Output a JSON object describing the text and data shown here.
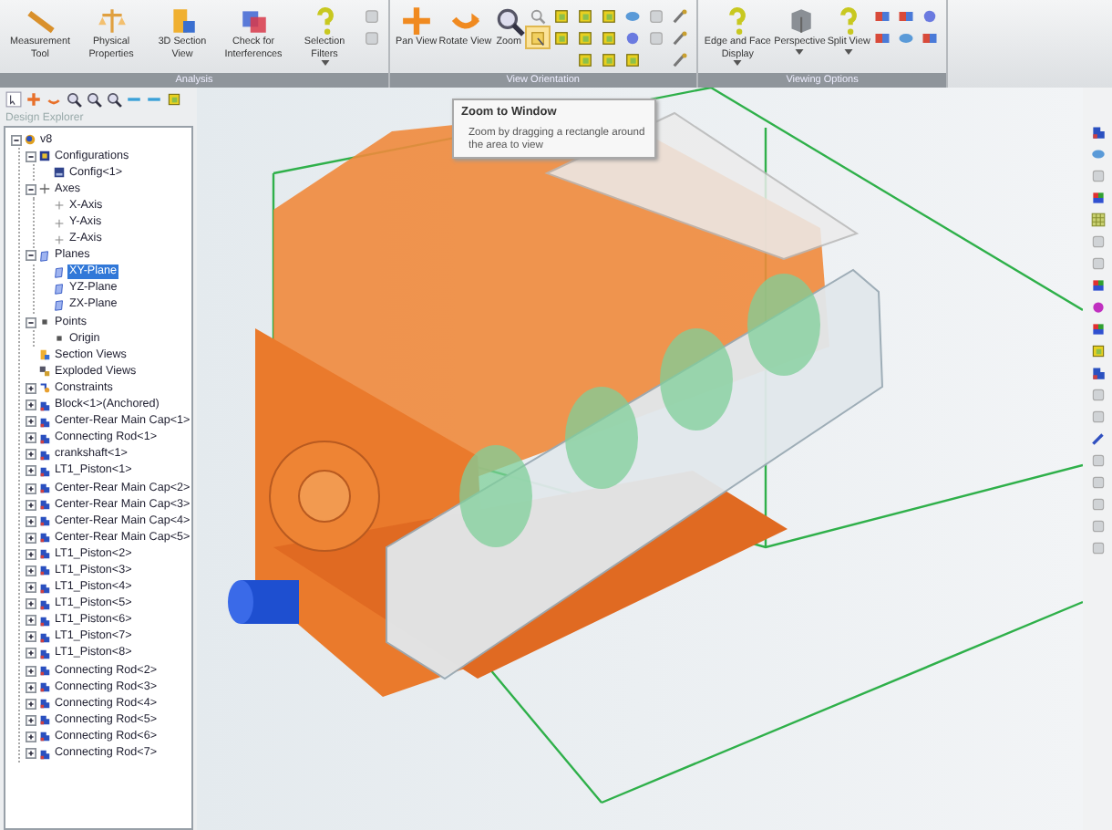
{
  "ribbon": {
    "groups": [
      {
        "label": "Analysis",
        "buttons": [
          {
            "label": "Measurement Tool",
            "kind": "ruler",
            "dropdown": false
          },
          {
            "label": "Physical Properties",
            "kind": "properties",
            "dropdown": false
          },
          {
            "label": "3D Section View",
            "kind": "section",
            "dropdown": false
          },
          {
            "label": "Check for Interferences",
            "kind": "interference",
            "dropdown": false
          },
          {
            "label": "Selection Filters",
            "kind": "question",
            "dropdown": true
          }
        ],
        "small_columns": [
          [
            {
              "kind": "grey",
              "highlighted": false
            },
            {
              "kind": "grey",
              "highlighted": false
            }
          ]
        ]
      },
      {
        "label": "View Orientation",
        "buttons": [
          {
            "label": "Pan View",
            "kind": "pan",
            "dropdown": false
          },
          {
            "label": "Rotate View",
            "kind": "rotate",
            "dropdown": false
          },
          {
            "label": "Zoom",
            "kind": "zoom",
            "dropdown": false
          }
        ],
        "small_columns": [
          [
            {
              "kind": "zoomgrey",
              "highlighted": false
            },
            {
              "kind": "zoomwin",
              "highlighted": true
            }
          ],
          [
            {
              "kind": "cube",
              "highlighted": false
            },
            {
              "kind": "cube",
              "highlighted": false
            }
          ],
          [
            {
              "kind": "cube",
              "highlighted": false
            },
            {
              "kind": "cube",
              "highlighted": false
            },
            {
              "kind": "cube",
              "highlighted": false
            }
          ],
          [
            {
              "kind": "cube",
              "highlighted": false
            },
            {
              "kind": "cube",
              "highlighted": false
            },
            {
              "kind": "cube",
              "highlighted": false
            }
          ],
          [
            {
              "kind": "blue",
              "highlighted": false
            },
            {
              "kind": "sphere",
              "highlighted": false
            },
            {
              "kind": "cube",
              "highlighted": false
            }
          ],
          [
            {
              "kind": "grey",
              "highlighted": false
            },
            {
              "kind": "grey",
              "highlighted": false
            }
          ],
          [
            {
              "kind": "tool",
              "highlighted": false
            },
            {
              "kind": "tool",
              "highlighted": false
            },
            {
              "kind": "tool",
              "highlighted": false
            }
          ]
        ]
      },
      {
        "label": "Viewing Options",
        "buttons": [
          {
            "label": "Edge and Face Display",
            "kind": "question",
            "dropdown": true
          },
          {
            "label": "Perspective",
            "kind": "perspective",
            "dropdown": true
          },
          {
            "label": "Split View",
            "kind": "question",
            "dropdown": true
          }
        ],
        "small_columns": [
          [
            {
              "kind": "color",
              "highlighted": false
            },
            {
              "kind": "color",
              "highlighted": false
            }
          ],
          [
            {
              "kind": "color",
              "highlighted": false
            },
            {
              "kind": "blue",
              "highlighted": false
            }
          ],
          [
            {
              "kind": "sphere",
              "highlighted": false
            },
            {
              "kind": "color",
              "highlighted": false
            }
          ]
        ]
      }
    ]
  },
  "toolbar": [
    {
      "kind": "select"
    },
    {
      "kind": "add"
    },
    {
      "kind": "undo"
    },
    {
      "kind": "zoom"
    },
    {
      "kind": "zoom"
    },
    {
      "kind": "zoom"
    },
    {
      "kind": "line"
    },
    {
      "kind": "line"
    },
    {
      "kind": "cube"
    }
  ],
  "explorer": {
    "title": "Design Explorer",
    "items": [
      {
        "label": "v8",
        "kind": "assembly",
        "selected": false,
        "expanded": true,
        "children": [
          {
            "label": "Configurations",
            "kind": "configs",
            "selected": false,
            "expanded": true,
            "children": [
              {
                "label": "Config<1>",
                "kind": "config",
                "selected": false
              }
            ]
          },
          {
            "label": "Axes",
            "kind": "axes",
            "selected": false,
            "expanded": true,
            "children": [
              {
                "label": "X-Axis",
                "kind": "axis",
                "selected": false
              },
              {
                "label": "Y-Axis",
                "kind": "axis",
                "selected": false
              },
              {
                "label": "Z-Axis",
                "kind": "axis",
                "selected": false
              }
            ]
          },
          {
            "label": "Planes",
            "kind": "plane",
            "selected": false,
            "expanded": true,
            "children": [
              {
                "label": "XY-Plane",
                "kind": "plane",
                "selected": true
              },
              {
                "label": "YZ-Plane",
                "kind": "plane",
                "selected": false
              },
              {
                "label": "ZX-Plane",
                "kind": "plane",
                "selected": false
              }
            ]
          },
          {
            "label": "Points",
            "kind": "point",
            "selected": false,
            "expanded": true,
            "children": [
              {
                "label": "Origin",
                "kind": "point",
                "selected": false
              }
            ]
          },
          {
            "label": "Section Views",
            "kind": "section",
            "selected": false
          },
          {
            "label": "Exploded Views",
            "kind": "exploded",
            "selected": false
          },
          {
            "label": "Constraints",
            "kind": "constraints",
            "selected": false,
            "expanded": false
          },
          {
            "label": "Block<1>(Anchored)",
            "kind": "part",
            "selected": false,
            "expanded": false
          },
          {
            "label": "Center-Rear Main Cap<1>",
            "kind": "part",
            "selected": false,
            "expanded": false
          },
          {
            "label": "Connecting Rod<1>",
            "kind": "part",
            "selected": false,
            "expanded": false
          },
          {
            "label": "crankshaft<1>",
            "kind": "part",
            "selected": false,
            "expanded": false
          },
          {
            "label": "LT1_Piston<1>",
            "kind": "part",
            "selected": false,
            "expanded": false
          },
          {
            "label": "Center-Rear Main Cap<2>",
            "kind": "part",
            "selected": false,
            "expanded": false
          },
          {
            "label": "Center-Rear Main Cap<3>",
            "kind": "part",
            "selected": false,
            "expanded": false
          },
          {
            "label": "Center-Rear Main Cap<4>",
            "kind": "part",
            "selected": false,
            "expanded": false
          },
          {
            "label": "Center-Rear Main Cap<5>",
            "kind": "part",
            "selected": false,
            "expanded": false
          },
          {
            "label": "LT1_Piston<2>",
            "kind": "part",
            "selected": false,
            "expanded": false
          },
          {
            "label": "LT1_Piston<3>",
            "kind": "part",
            "selected": false,
            "expanded": false
          },
          {
            "label": "LT1_Piston<4>",
            "kind": "part",
            "selected": false,
            "expanded": false
          },
          {
            "label": "LT1_Piston<5>",
            "kind": "part",
            "selected": false,
            "expanded": false
          },
          {
            "label": "LT1_Piston<6>",
            "kind": "part",
            "selected": false,
            "expanded": false
          },
          {
            "label": "LT1_Piston<7>",
            "kind": "part",
            "selected": false,
            "expanded": false
          },
          {
            "label": "LT1_Piston<8>",
            "kind": "part",
            "selected": false,
            "expanded": false
          },
          {
            "label": "Connecting Rod<2>",
            "kind": "part",
            "selected": false,
            "expanded": false
          },
          {
            "label": "Connecting Rod<3>",
            "kind": "part",
            "selected": false,
            "expanded": false
          },
          {
            "label": "Connecting Rod<4>",
            "kind": "part",
            "selected": false,
            "expanded": false
          },
          {
            "label": "Connecting Rod<5>",
            "kind": "part",
            "selected": false,
            "expanded": false
          },
          {
            "label": "Connecting Rod<6>",
            "kind": "part",
            "selected": false,
            "expanded": false
          },
          {
            "label": "Connecting Rod<7>",
            "kind": "part",
            "selected": false,
            "expanded": false
          }
        ]
      }
    ]
  },
  "tooltip": {
    "title": "Zoom to Window",
    "text": "Zoom by dragging a rectangle around the area to view"
  },
  "side_toolbar": [
    {
      "kind": "part"
    },
    {
      "kind": "blue"
    },
    {
      "kind": "grey"
    },
    {
      "kind": "colorcube"
    },
    {
      "kind": "grid"
    },
    {
      "kind": "grey"
    },
    {
      "kind": "grey"
    },
    {
      "kind": "colorcube"
    },
    {
      "kind": "magenta"
    },
    {
      "kind": "colorcube"
    },
    {
      "kind": "cube"
    },
    {
      "kind": "part"
    },
    {
      "kind": "grey"
    },
    {
      "kind": "grey"
    },
    {
      "kind": "pen"
    },
    {
      "kind": "grey"
    },
    {
      "kind": "grey"
    },
    {
      "kind": "grey"
    },
    {
      "kind": "grey"
    },
    {
      "kind": "grey"
    }
  ]
}
